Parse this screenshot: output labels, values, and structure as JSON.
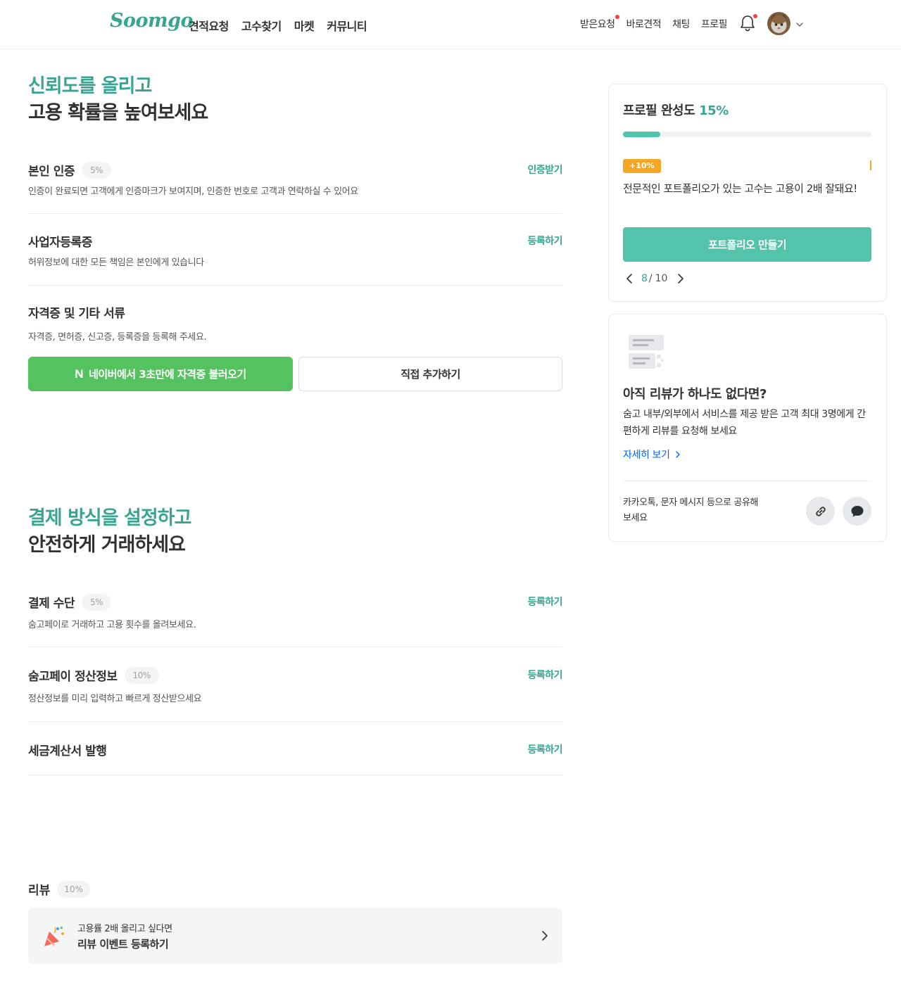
{
  "header": {
    "logo": "Soomgo",
    "nav_main": [
      "견적요청",
      "고수찾기",
      "마켓",
      "커뮤니티"
    ],
    "nav_right": [
      "받은요청",
      "바로견적",
      "채팅",
      "프로필"
    ],
    "icons": {
      "bell": "bell-icon",
      "avatar": "avatar",
      "caret": "chevron-down-icon"
    },
    "colors": {
      "brand": "#3aa493",
      "notification_dot": "#fa3e3e"
    }
  },
  "trust_section": {
    "heading_accent": "신뢰도를 올리고",
    "heading_main": "고용 확률을 높여보세요",
    "items": [
      {
        "title": "본인 인증",
        "badge": "5%",
        "desc": "인증이 완료되면 고객에게 인증마크가 보여지며, 인증한 번호로 고객과 연락하실 수 있어요",
        "action": "인증받기"
      },
      {
        "title": "사업자등록증",
        "desc": "허위정보에 대한 모든 책임은 본인에게 있습니다",
        "action": "등록하기"
      },
      {
        "title": "자격증 및 기타 서류",
        "desc": "자격증, 면허증, 신고증, 등록증을 등록해 주세요."
      }
    ],
    "naver_button": {
      "mark": "N",
      "label": "네이버에서 3초만에 자격증 불러오기",
      "color": "#54c35f"
    },
    "direct_button": "직접 추가하기"
  },
  "payment_section": {
    "heading_accent": "결제 방식을 설정하고",
    "heading_main": "안전하게 거래하세요",
    "items": [
      {
        "title": "결제 수단",
        "badge": "5%",
        "desc": "숨고페이로 거래하고 고용 횟수를 올려보세요.",
        "action": "등록하기"
      },
      {
        "title": "숨고페이 정산정보",
        "badge": "10%",
        "desc": "정산정보를 미리 입력하고 빠르게 정산받으세요",
        "action": "등록하기"
      },
      {
        "title": "세금계산서 발행",
        "action": "등록하기"
      }
    ]
  },
  "review_section": {
    "title": "리뷰",
    "badge": "10%",
    "banner_sub": "고용률 2배 올리고 싶다면",
    "banner_main": "리뷰 이벤트 등록하기"
  },
  "profile_card": {
    "title": "프로필 완성도",
    "percent_label": "15%",
    "progress": 0.15,
    "tip_badge": "+10%",
    "tip_text": "전문적인 포트폴리오가 있는 고수는 고용이 2배 잘돼요!",
    "button": "포트폴리오 만들기",
    "pager": {
      "current": "8",
      "sep": "/",
      "total": "10"
    },
    "colors": {
      "progress": "#54c3ab",
      "badge": "#f5a623"
    }
  },
  "review_card": {
    "title": "아직 리뷰가 하나도 없다면?",
    "desc": "숨고 내부/외부에서 서비스를 제공 받은 고객 최대 3명에게 간편하게 리뷰를 요청해 보세요",
    "more": "자세히 보기",
    "share_text": "카카오톡, 문자 메시지 등으로 공유해 보세요",
    "share_icons": [
      "link-icon",
      "chat-bubble-icon"
    ],
    "colors": {
      "link": "#0064ff"
    }
  }
}
